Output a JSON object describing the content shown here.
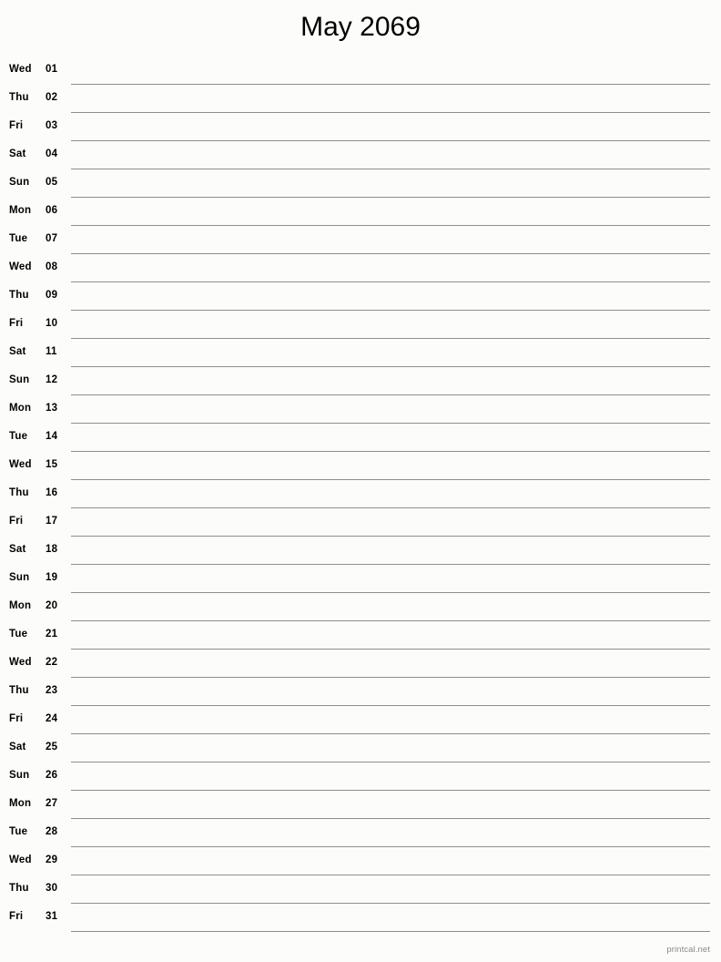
{
  "page": {
    "title": "May 2069",
    "month": "May",
    "year": "2069",
    "background_color": "#fcfdfa",
    "line_color": "#8c8f8c",
    "text_color": "#000000"
  },
  "footer": {
    "brand": "printcal.net",
    "color": "#8a8a8a"
  },
  "days": [
    {
      "weekday": "Wed",
      "date": "01"
    },
    {
      "weekday": "Thu",
      "date": "02"
    },
    {
      "weekday": "Fri",
      "date": "03"
    },
    {
      "weekday": "Sat",
      "date": "04"
    },
    {
      "weekday": "Sun",
      "date": "05"
    },
    {
      "weekday": "Mon",
      "date": "06"
    },
    {
      "weekday": "Tue",
      "date": "07"
    },
    {
      "weekday": "Wed",
      "date": "08"
    },
    {
      "weekday": "Thu",
      "date": "09"
    },
    {
      "weekday": "Fri",
      "date": "10"
    },
    {
      "weekday": "Sat",
      "date": "11"
    },
    {
      "weekday": "Sun",
      "date": "12"
    },
    {
      "weekday": "Mon",
      "date": "13"
    },
    {
      "weekday": "Tue",
      "date": "14"
    },
    {
      "weekday": "Wed",
      "date": "15"
    },
    {
      "weekday": "Thu",
      "date": "16"
    },
    {
      "weekday": "Fri",
      "date": "17"
    },
    {
      "weekday": "Sat",
      "date": "18"
    },
    {
      "weekday": "Sun",
      "date": "19"
    },
    {
      "weekday": "Mon",
      "date": "20"
    },
    {
      "weekday": "Tue",
      "date": "21"
    },
    {
      "weekday": "Wed",
      "date": "22"
    },
    {
      "weekday": "Thu",
      "date": "23"
    },
    {
      "weekday": "Fri",
      "date": "24"
    },
    {
      "weekday": "Sat",
      "date": "25"
    },
    {
      "weekday": "Sun",
      "date": "26"
    },
    {
      "weekday": "Mon",
      "date": "27"
    },
    {
      "weekday": "Tue",
      "date": "28"
    },
    {
      "weekday": "Wed",
      "date": "29"
    },
    {
      "weekday": "Thu",
      "date": "30"
    },
    {
      "weekday": "Fri",
      "date": "31"
    }
  ]
}
